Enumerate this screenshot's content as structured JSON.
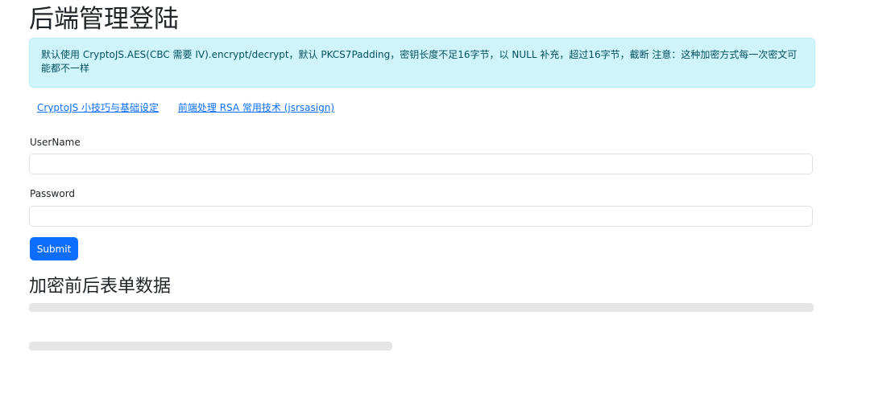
{
  "header": {
    "title": "后端管理登陆"
  },
  "alert": {
    "text": "默认使用 CryptoJS.AES(CBC 需要 IV).encrypt/decrypt，默认 PKCS7Padding，密钥长度不足16字节，以 NULL 补充，超过16字节，截断 注意：这种加密方式每一次密文可能都不一样"
  },
  "links": [
    {
      "label": "CryptoJS 小技巧与基础设定"
    },
    {
      "label": "前端处理 RSA 常用技术 (jsrsasign)"
    }
  ],
  "form": {
    "username_label": "UserName",
    "username_value": "",
    "password_label": "Password",
    "password_value": "",
    "submit_label": "Submit"
  },
  "result": {
    "title": "加密前后表单数据"
  },
  "colors": {
    "primary": "#0d6efd",
    "alert_bg": "#cff4fc",
    "alert_text": "#055160"
  }
}
